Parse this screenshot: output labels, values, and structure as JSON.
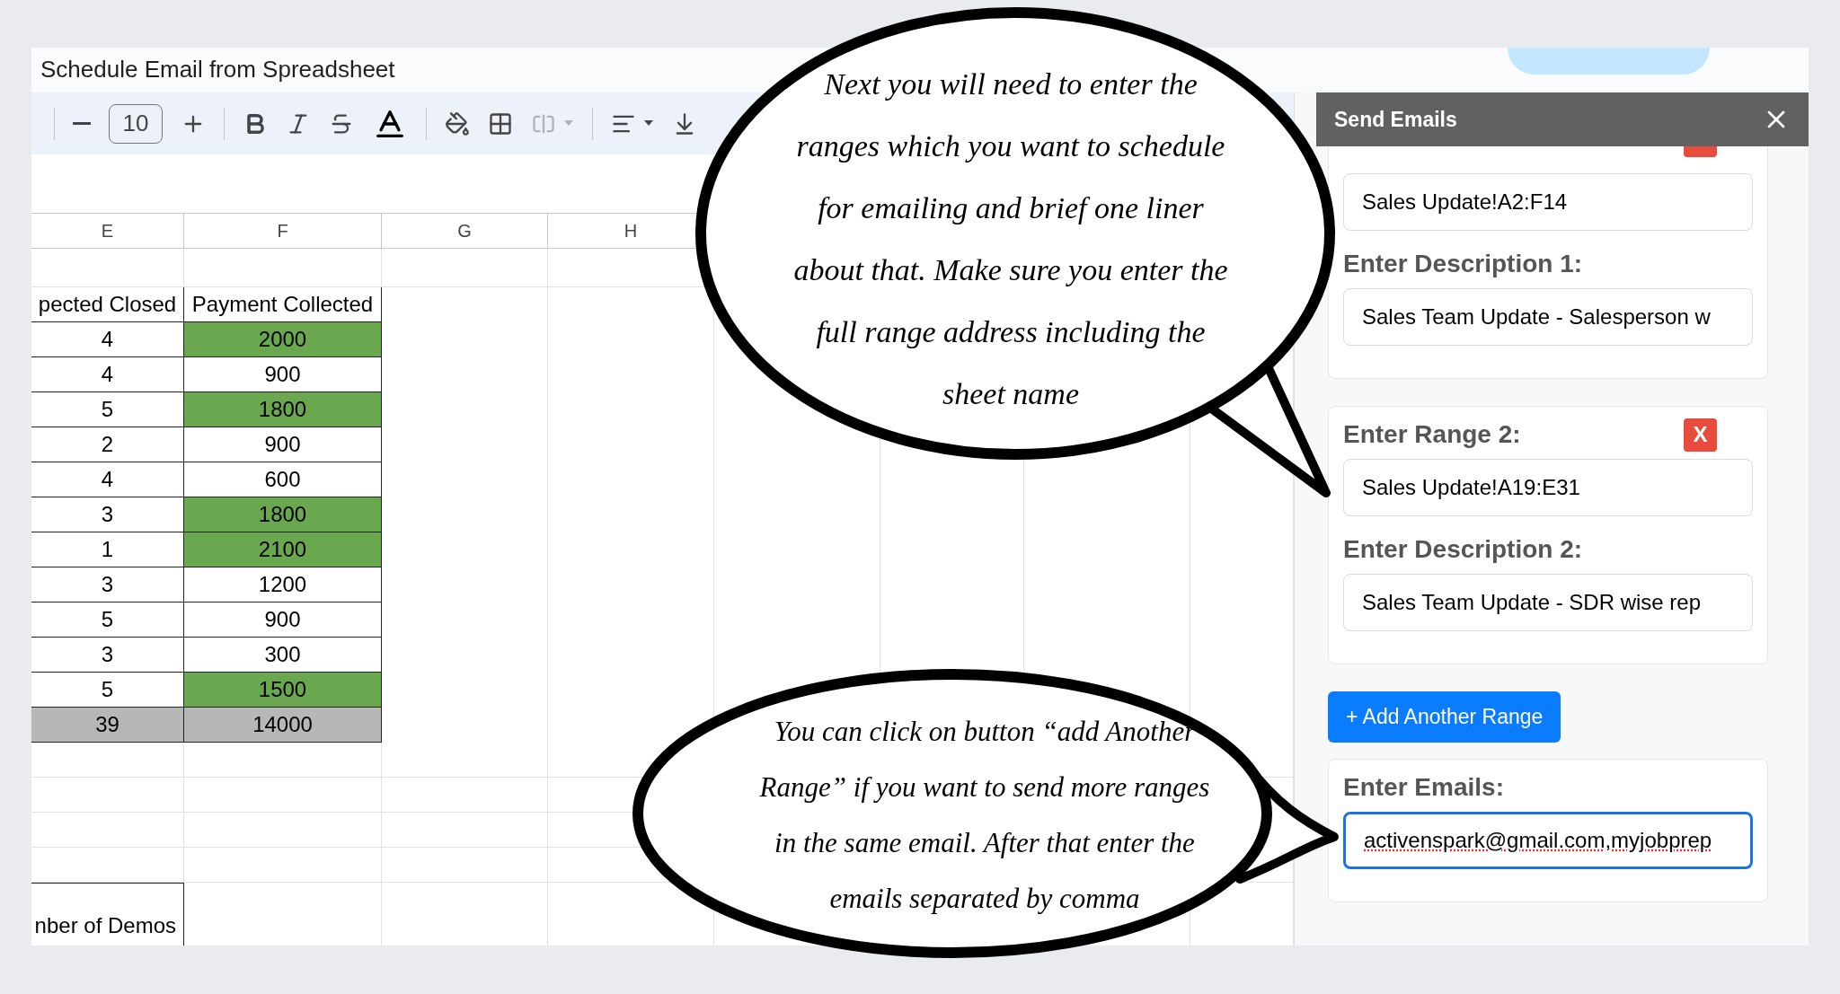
{
  "document": {
    "title": "Schedule Email from Spreadsheet"
  },
  "toolbar": {
    "font_size": "10"
  },
  "sheet": {
    "columns": [
      "E",
      "F",
      "G",
      "H"
    ],
    "header": [
      "pected Closed",
      "Payment Collected"
    ],
    "rows": [
      {
        "cells": [
          "4",
          "2000"
        ],
        "highlighted": true
      },
      {
        "cells": [
          "4",
          "900"
        ],
        "highlighted": false
      },
      {
        "cells": [
          "5",
          "1800"
        ],
        "highlighted": true
      },
      {
        "cells": [
          "2",
          "900"
        ],
        "highlighted": false
      },
      {
        "cells": [
          "4",
          "600"
        ],
        "highlighted": false
      },
      {
        "cells": [
          "3",
          "1800"
        ],
        "highlighted": true
      },
      {
        "cells": [
          "1",
          "2100"
        ],
        "highlighted": true
      },
      {
        "cells": [
          "3",
          "1200"
        ],
        "highlighted": false
      },
      {
        "cells": [
          "5",
          "900"
        ],
        "highlighted": false
      },
      {
        "cells": [
          "3",
          "300"
        ],
        "highlighted": false
      },
      {
        "cells": [
          "5",
          "1500"
        ],
        "highlighted": true
      }
    ],
    "total": [
      "39",
      "14000"
    ],
    "lower_label": "nber of Demos"
  },
  "sidebar": {
    "title": "Send Emails",
    "ranges": [
      {
        "range": "Sales Update!A2:F14",
        "description_label": "Enter Description 1:",
        "description": "Sales Team Update - Salesperson w"
      },
      {
        "label": "Enter Range 2:",
        "remove": "X",
        "range": "Sales Update!A19:E31",
        "description_label": "Enter Description 2:",
        "description": "Sales Team Update - SDR wise rep"
      }
    ],
    "add_button": "+ Add Another Range",
    "emails": {
      "label": "Enter Emails:",
      "value": "activenspark@gmail.com,myjobprep",
      "focused": true
    }
  },
  "annotations": [
    {
      "text": "Next you will need to enter the\nranges which you want to schedule\nfor emailing and brief one liner\nabout that. Make sure you enter the\nfull range address including the\nsheet name"
    },
    {
      "text": "You can click on button “add Another\nRange” if you want to send more ranges\nin the same email. After that enter the\nemails separated by comma"
    }
  ]
}
